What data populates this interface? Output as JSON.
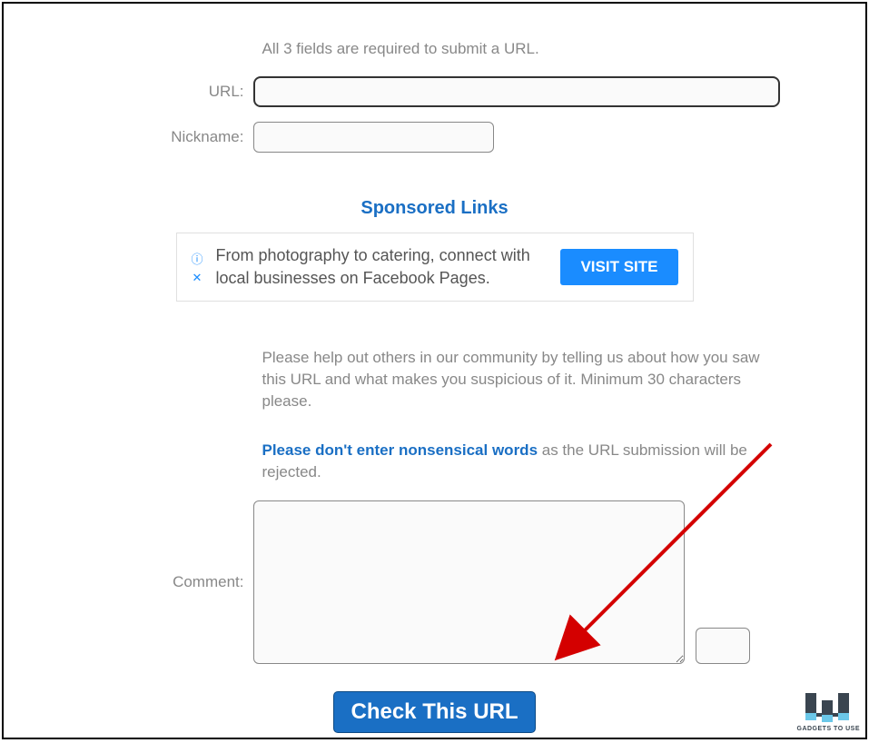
{
  "instruction": "All 3 fields are required to submit a URL.",
  "labels": {
    "url": "URL:",
    "nickname": "Nickname:",
    "comment": "Comment:"
  },
  "inputs": {
    "url_value": "",
    "nickname_value": "",
    "comment_value": ""
  },
  "sponsored": {
    "heading": "Sponsored Links",
    "ad_text": "From photography to catering, connect with local businesses on Facebook Pages.",
    "visit_label": "VISIT SITE"
  },
  "help_text": "Please help out others in our community by telling us about how you saw this URL and what makes you suspicious of it. Minimum 30 characters please.",
  "warning": {
    "bold": "Please don't enter nonsensical words",
    "rest": " as the URL submission will be rejected."
  },
  "submit_label": "Check This URL",
  "logo_text": "GADGETS TO USE"
}
